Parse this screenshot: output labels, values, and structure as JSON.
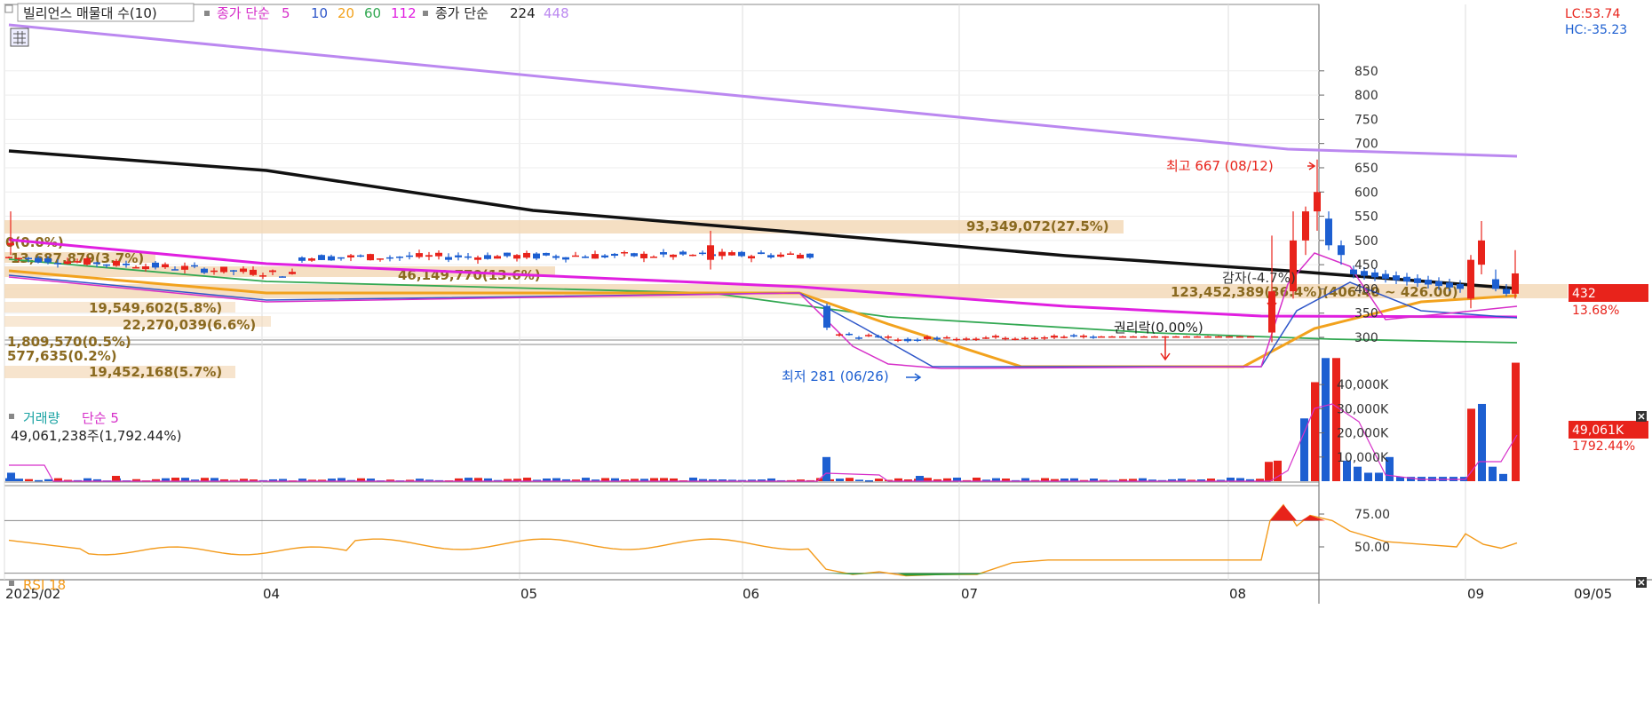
{
  "colors": {
    "up": "#e8231b",
    "down": "#1d5fd1",
    "ma5": "#d62fc9",
    "ma10": "#2e56c9",
    "ma20": "#f2a21d",
    "ma60": "#32a852",
    "ma112": "#e01fe0",
    "ma224": "#111111",
    "ma448": "#bb88f0",
    "profile": "#f3d9b8",
    "profileText": "#8a6a20",
    "rsi": "#f39a1a",
    "grid": "#dddddd"
  },
  "legend": {
    "name": "빌리언스 매물대 수(10)",
    "close_simple": "종가 단순",
    "ma_short": [
      "5",
      "10",
      "20",
      "60",
      "112"
    ],
    "close_simple2": "종가 단순",
    "ma_long": [
      "224",
      "448"
    ]
  },
  "corner": {
    "lc": "LC:53.74",
    "hc": "HC:-35.23"
  },
  "price_panel": {
    "current_price": "432",
    "current_change": "13.68%",
    "high_label": "최고 667 (08/12)",
    "low_label": "최저 281 (06/26)",
    "rights_label": "권리락(0.00%)",
    "range_label": "123,452,389(36.4%)(406.40 ~ 426.00)",
    "overlap_label": "감자(-4.7%)",
    "profile_labels": [
      "0(0.0%)",
      "13,687,879(3.7%)",
      "46,149,770(13.6%)",
      "93,349,072(27.5%)",
      "19,549,602(5.8%)",
      "22,270,039(6.6%)",
      "1,809,570(0.5%)",
      "577,635(0.2%)",
      "19,452,168(5.7%)"
    ]
  },
  "volume_panel": {
    "title": "거래량",
    "ma_label": "단순 5",
    "last_volume": "49,061,238주(1,792.44%)",
    "badge": "49,061K",
    "badge_pct": "1792.44%"
  },
  "rsi_panel": {
    "title": "RSI 18"
  },
  "x_axis": {
    "labels": [
      "2025/02",
      "04",
      "05",
      "06",
      "07",
      "08",
      "09",
      "09/05"
    ]
  },
  "chart_data": [
    {
      "type": "candlestick",
      "title": "빌리언스 매물대 수(10)",
      "y_ticks": [
        300,
        350,
        400,
        450,
        500,
        550,
        600,
        650,
        700,
        750,
        800,
        850
      ],
      "ylim": [
        260,
        885
      ],
      "x_period": [
        "2025/02",
        "09/05"
      ],
      "candles_approx": [
        {
          "month": "2025/02",
          "open": 490,
          "high": 560,
          "low": 470,
          "close": 465
        },
        {
          "month": "04",
          "open": 445,
          "high": 475,
          "low": 405,
          "close": 440
        },
        {
          "month": "05",
          "open": 430,
          "high": 470,
          "low": 418,
          "close": 440
        },
        {
          "month": "06",
          "open": 445,
          "high": 520,
          "low": 432,
          "close": 450
        },
        {
          "month": "06",
          "open": 370,
          "high": 370,
          "low": 310,
          "close": 310
        },
        {
          "month": "06/26",
          "low": 281
        },
        {
          "month": "07",
          "open": 300,
          "high": 305,
          "low": 295,
          "close": 300
        },
        {
          "month": "08",
          "open": 310,
          "high": 510,
          "low": 290,
          "close": 395
        },
        {
          "month": "08/12",
          "high": 667,
          "close": 560
        },
        {
          "month": "09",
          "open": 390,
          "high": 540,
          "low": 360,
          "close": 432
        }
      ],
      "moving_averages": [
        {
          "name": "5",
          "start": 460,
          "end": 395
        },
        {
          "name": "10",
          "start": 458,
          "end": 400
        },
        {
          "name": "20",
          "start": 455,
          "end": 428
        },
        {
          "name": "60",
          "start": 452,
          "end": 348
        },
        {
          "name": "112",
          "start": 528,
          "end": 388
        },
        {
          "name": "224",
          "start": 685,
          "end": 437
        },
        {
          "name": "448",
          "start": 1000,
          "end": 675
        }
      ],
      "volume_profile": [
        {
          "price_range": [
            540,
            560
          ],
          "volume": "93,349,072",
          "pct": 27.5
        },
        {
          "price_range": [
            410,
            440
          ],
          "volume": "123,452,389",
          "pct": 36.4
        },
        {
          "price_range": [
            470,
            480
          ],
          "volume": "46,149,770",
          "pct": 13.6
        }
      ]
    },
    {
      "type": "bar",
      "title": "거래량",
      "y_ticks": [
        "10,000K",
        "20,000K",
        "30,000K",
        "40,000K"
      ],
      "ylim": [
        0,
        52000
      ],
      "last_value_k": 49061,
      "spikes_k": [
        {
          "month": "08",
          "up": [
            8000,
            8500,
            41000,
            51000
          ],
          "down": [
            26000,
            51000
          ]
        },
        {
          "month": "09",
          "up": [
            30000,
            49061
          ],
          "down": [
            32000,
            6000
          ]
        }
      ]
    },
    {
      "type": "line",
      "title": "RSI 18",
      "y_ticks": [
        "50.00",
        "75.00"
      ],
      "ylim": [
        30,
        100
      ],
      "reference_levels": [
        30,
        70
      ],
      "series": [
        {
          "name": "RSI 18"
        }
      ]
    }
  ]
}
